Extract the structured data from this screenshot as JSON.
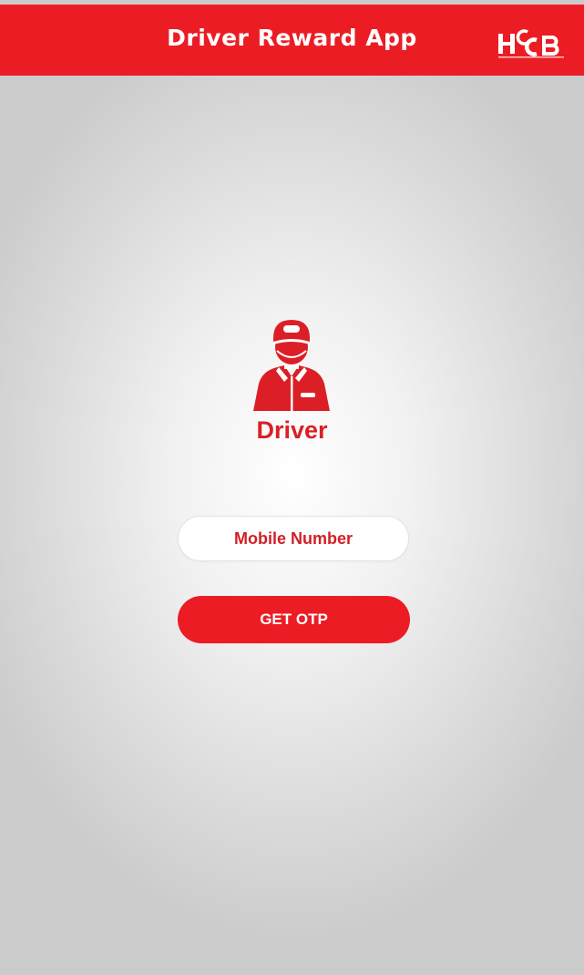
{
  "header": {
    "title": "Driver Reward App",
    "logo_text": "HCCB",
    "logo_icon": "hccb-logo-icon"
  },
  "role": {
    "icon": "driver-icon",
    "label": "Driver"
  },
  "form": {
    "mobile_placeholder": "Mobile Number",
    "submit_label": "GET OTP"
  },
  "colors": {
    "brand_red": "#ec1c24",
    "text_red": "#dc1f26",
    "field_bg": "#ffffff",
    "background_center": "#ffffff",
    "background_edge": "#cbcbcb"
  }
}
